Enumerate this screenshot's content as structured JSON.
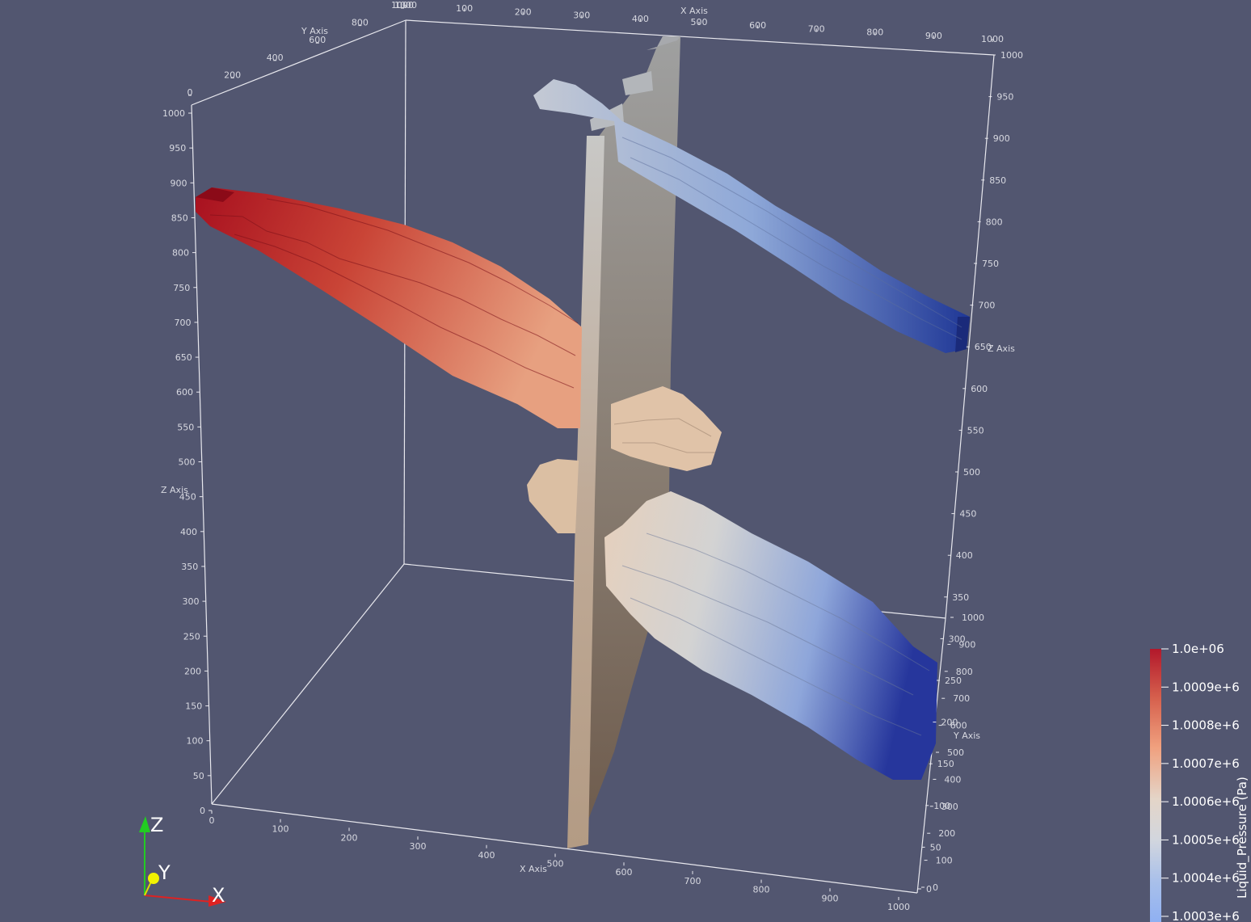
{
  "axes": {
    "x_title": "X Axis",
    "y_title": "Y Axis",
    "z_title": "Z Axis",
    "x_front_ticks": [
      "0",
      "100",
      "200",
      "300",
      "400",
      "500",
      "600",
      "700",
      "800",
      "900",
      "1000"
    ],
    "x_back_ticks": [
      "1000",
      "100",
      "200",
      "300",
      "400",
      "500",
      "600",
      "700",
      "800",
      "900",
      "1000"
    ],
    "y_left_ticks": [
      "0",
      "200",
      "400",
      "600",
      "800",
      "1000"
    ],
    "y_right_ticks": [
      "0",
      "100",
      "200",
      "300",
      "400",
      "500",
      "600",
      "700",
      "800",
      "900",
      "1000"
    ],
    "z_left_ticks": [
      "0",
      "50",
      "100",
      "150",
      "200",
      "250",
      "300",
      "350",
      "400",
      "450",
      "500",
      "550",
      "600",
      "650",
      "700",
      "750",
      "800",
      "850",
      "900",
      "950",
      "1000"
    ],
    "z_right_ticks": [
      "0",
      "50",
      "100",
      "150",
      "200",
      "250",
      "300",
      "350",
      "400",
      "450",
      "500",
      "550",
      "600",
      "650",
      "700",
      "750",
      "800",
      "850",
      "900",
      "950",
      "1000"
    ]
  },
  "colorbar": {
    "title": "Liquid_Pressure (Pa)",
    "labels": [
      "1.0e+06",
      "1.0009e+6",
      "1.0008e+6",
      "1.0007e+6",
      "1.0006e+6",
      "1.0005e+6",
      "1.0004e+6",
      "1.0003e+6"
    ],
    "colors": [
      "#b2182b",
      "#d6604d",
      "#f4a582",
      "#e0d2c4",
      "#d0d5e0",
      "#92b0e6",
      "#4f6fc8",
      "#23329a"
    ]
  },
  "orientation_triad": {
    "x": "X",
    "y": "Y",
    "z": "Z"
  },
  "colors": {
    "background": "#525670",
    "fault_plane": "#8f7f70",
    "high": "#b2182b",
    "mid": "#dcdcdc",
    "low": "#23329a"
  }
}
